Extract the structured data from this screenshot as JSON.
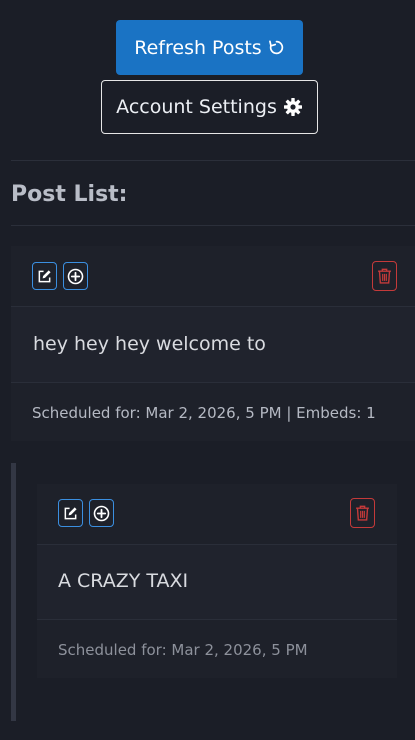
{
  "toolbar": {
    "refresh_label": "Refresh Posts",
    "account_label": "Account Settings"
  },
  "post_list": {
    "title": "Post List:"
  },
  "posts": [
    {
      "text": "hey hey hey welcome to",
      "meta": "Scheduled for: Mar 2, 2026, 5 PM | Embeds: 1"
    },
    {
      "text": "A CRAZY TAXI",
      "meta": "Scheduled for: Mar 2, 2026, 5 PM"
    }
  ],
  "icons": {
    "refresh": "refresh-icon",
    "settings": "gear-icon",
    "edit": "edit-icon",
    "add": "plus-circle-icon",
    "delete": "trash-icon"
  },
  "colors": {
    "background": "#1b1e27",
    "primary": "#1a73c4",
    "accent_blue": "#3b8fe0",
    "danger": "#c43a3a"
  }
}
